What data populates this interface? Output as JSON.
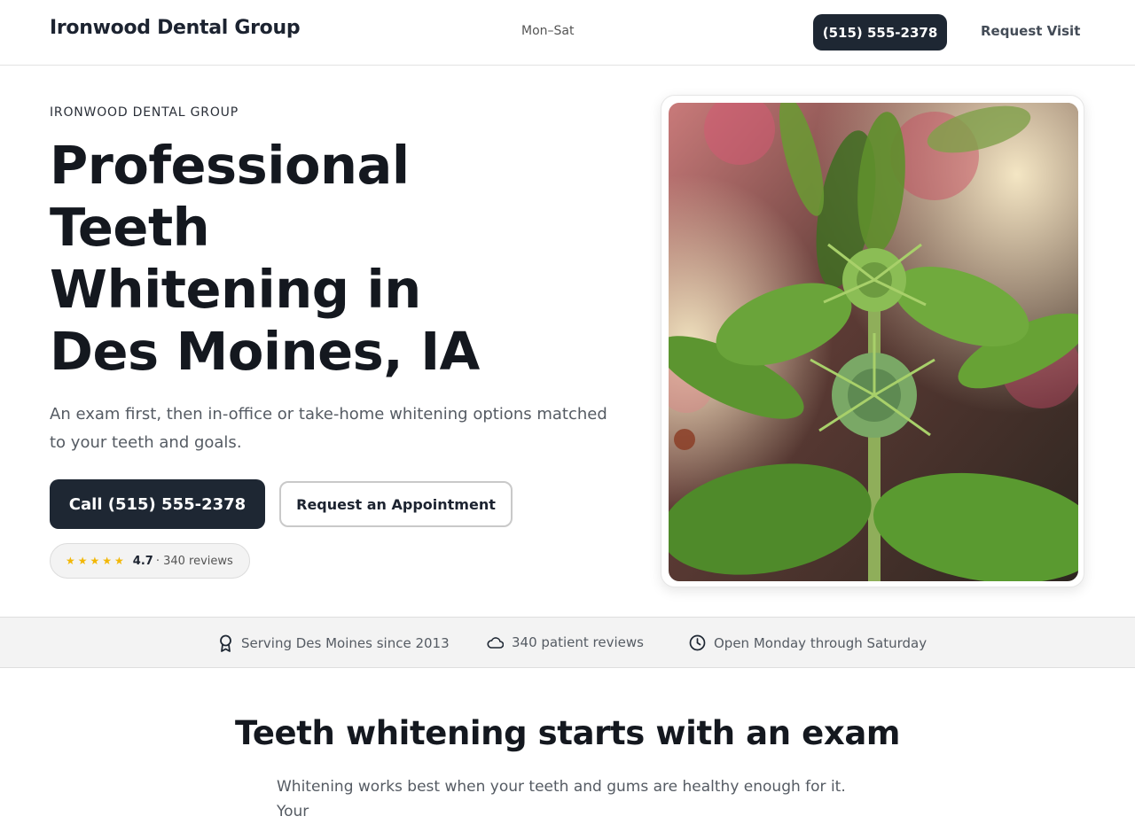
{
  "header": {
    "brand": "Ironwood Dental Group",
    "hours": "Mon–Sat",
    "phone_button": "(515) 555-2378",
    "request_link": "Request Visit"
  },
  "hero": {
    "eyebrow": "IRONWOOD DENTAL GROUP",
    "title": "Professional Teeth Whitening in Des Moines, IA",
    "subtitle": "An exam first, then in-office or take-home whitening options matched to your teeth and goals.",
    "call_button": "Call (515) 555-2378",
    "appointment_button": "Request an Appointment",
    "rating": {
      "stars": "★★★★★",
      "value": "4.7",
      "reviews": "· 340 reviews"
    }
  },
  "trust_bar": {
    "items": [
      {
        "icon": "award-ribbon-icon",
        "label": "Serving Des Moines since 2013"
      },
      {
        "icon": "cloud-icon",
        "label": "340 patient reviews"
      },
      {
        "icon": "clock-icon",
        "label": "Open Monday through Saturday"
      }
    ]
  },
  "section": {
    "title": "Teeth whitening starts with an exam",
    "body": "Whitening works best when your teeth and gums are healthy enough for it. Your"
  },
  "colors": {
    "primary_dark": "#1e2733",
    "star": "#f2b705",
    "text_muted": "#555b63"
  }
}
